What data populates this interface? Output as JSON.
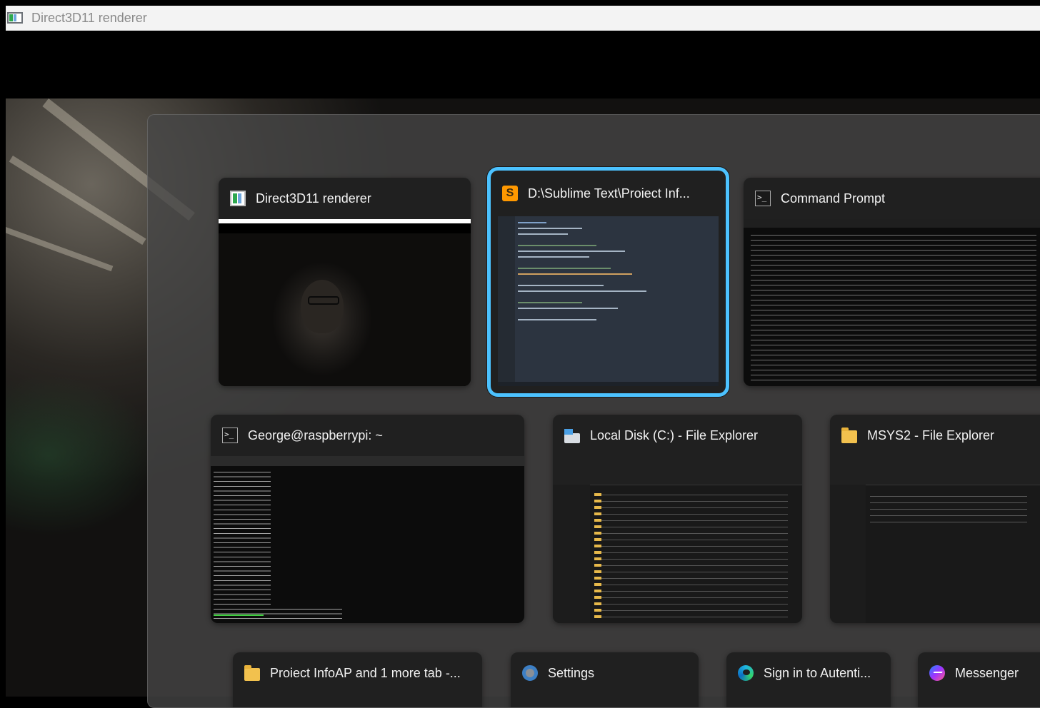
{
  "window": {
    "title": "Direct3D11 renderer",
    "icon": "direct3d-app-icon"
  },
  "switcher": {
    "windows": [
      {
        "title": "Direct3D11 renderer",
        "icon": "direct3d-app-icon",
        "selected": false
      },
      {
        "title": "D:\\Sublime Text\\Proiect Inf...",
        "icon": "sublime-text-icon",
        "selected": true
      },
      {
        "title": "Command Prompt",
        "icon": "command-prompt-icon",
        "selected": false
      },
      {
        "title": "George@raspberrypi: ~",
        "icon": "terminal-icon",
        "selected": false
      },
      {
        "title": "Local Disk (C:) - File Explorer",
        "icon": "drive-icon",
        "selected": false
      },
      {
        "title": "MSYS2 - File Explorer",
        "icon": "folder-icon",
        "selected": false
      },
      {
        "title": "Proiect InfoAP and 1 more tab -...",
        "icon": "folder-icon",
        "selected": false
      },
      {
        "title": "Settings",
        "icon": "settings-gear-icon",
        "selected": false
      },
      {
        "title": "Sign in to Autenti...",
        "icon": "edge-browser-icon",
        "selected": false
      },
      {
        "title": "Messenger",
        "icon": "messenger-icon",
        "selected": false
      }
    ]
  },
  "colors": {
    "selection": "#4cc2ff",
    "card_bg": "#202020",
    "switcher_bg": "#464646"
  }
}
